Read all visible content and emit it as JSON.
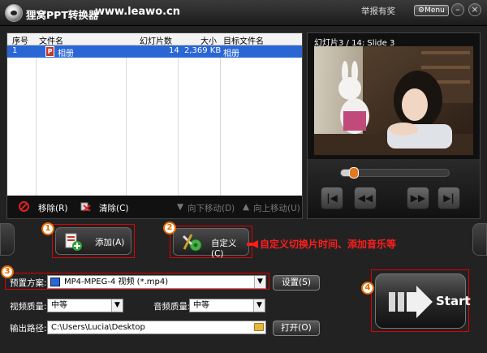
{
  "titlebar": {
    "app_title": "狸窝PPT转换器",
    "url": "www.leawo.cn",
    "report_link": "举报有奖",
    "menu_label": "Menu",
    "minimize_glyph": "–",
    "close_glyph": "×"
  },
  "file_table": {
    "headers": [
      "序号",
      "文件名",
      "幻灯片数",
      "大小",
      "目标文件名"
    ],
    "rows": [
      {
        "index": "1",
        "file_name": "相册",
        "slides": "14",
        "size": "2,369 KB",
        "target_name": "相册"
      }
    ]
  },
  "file_actions": {
    "remove": "移除(R)",
    "clear": "清除(C)",
    "move_down": "向下移动(D)",
    "move_up": "向上移动(U)"
  },
  "preview": {
    "slide_label": "幻灯片3 / 14: Slide 3",
    "progress": 0.12
  },
  "buttons": {
    "add": "添加(A)",
    "custom": "自定义(C)",
    "settings": "设置(S)",
    "open": "打开(O)",
    "start": "Start"
  },
  "annotations": {
    "n1": "1",
    "n2": "2",
    "n3": "3",
    "n4": "4",
    "custom_note": "自定义切换片时间、添加音乐等"
  },
  "form": {
    "preset_label": "预置方案:",
    "preset_value": "MP4-MPEG-4 视频 (*.mp4)",
    "video_quality_label": "视频质量:",
    "video_quality_value": "中等",
    "audio_quality_label": "音频质量:",
    "audio_quality_value": "中等",
    "output_path_label": "输出路径:",
    "output_path_value": "C:\\Users\\Lucia\\Desktop"
  },
  "colors": {
    "accent_red": "#e00000",
    "number_orange": "#e76a00",
    "selection_blue": "#2a66d4"
  }
}
